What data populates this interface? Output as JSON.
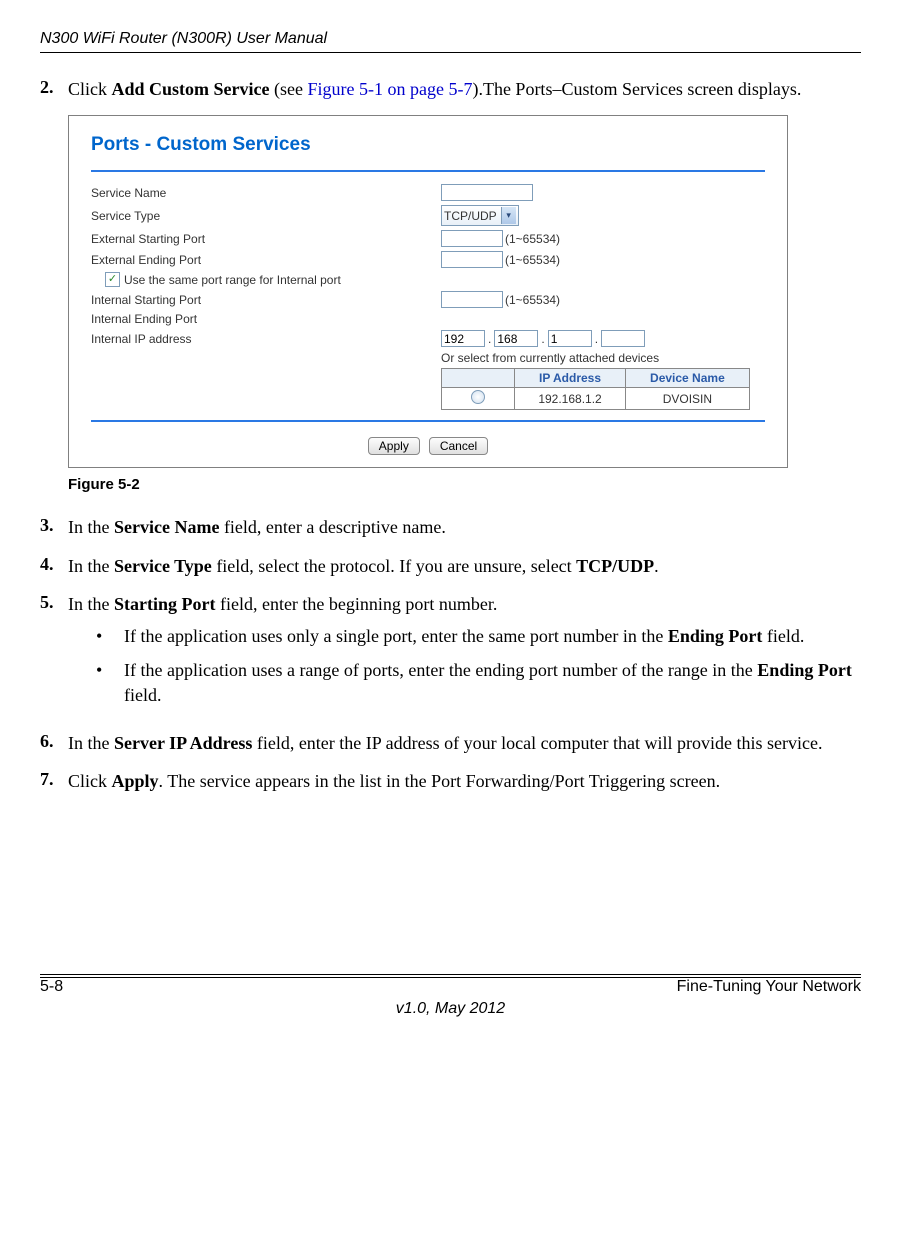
{
  "header_title": "N300 WiFi Router (N300R) User Manual",
  "steps": {
    "s2_num": "2.",
    "s2_a": "Click ",
    "s2_b": "Add Custom Service",
    "s2_c": " (see ",
    "s2_link": "Figure 5-1 on page 5-7",
    "s2_d": ").The Ports–Custom Services screen displays.",
    "s3_num": "3.",
    "s3_a": "In the ",
    "s3_b": "Service Name",
    "s3_c": " field, enter a descriptive name.",
    "s4_num": "4.",
    "s4_a": "In the ",
    "s4_b": "Service Type",
    "s4_c": " field, select the protocol. If you are unsure, select ",
    "s4_d": "TCP/UDP",
    "s4_e": ".",
    "s5_num": "5.",
    "s5_a": "In the ",
    "s5_b": "Starting Port",
    "s5_c": " field, enter the beginning port number.",
    "s5_bul1_a": "If the application uses only a single port, enter the same port number in the ",
    "s5_bul1_b": "Ending Port",
    "s5_bul1_c": " field.",
    "s5_bul2_a": "If the application uses a range of ports, enter the ending port number of the range in the ",
    "s5_bul2_b": "Ending Port",
    "s5_bul2_c": " field.",
    "s6_num": "6.",
    "s6_a": "In the ",
    "s6_b": "Server IP Address",
    "s6_c": " field, enter the IP address of your local computer that will provide this service.",
    "s7_num": "7.",
    "s7_a": "Click ",
    "s7_b": "Apply",
    "s7_c": ". The service appears in the list in the Port Forwarding/Port Triggering screen."
  },
  "figure": {
    "panel_title": "Ports - Custom Services",
    "labels": {
      "service_name": "Service Name",
      "service_type": "Service Type",
      "ext_start": "External Starting Port",
      "ext_end": "External Ending Port",
      "same_range": "Use the same port range for Internal port",
      "int_start": "Internal Starting Port",
      "int_end": "Internal Ending Port",
      "int_ip": "Internal IP address"
    },
    "service_type_value": "TCP/UDP",
    "port_hint": "(1~65534)",
    "ip": {
      "o1": "192",
      "o2": "168",
      "o3": "1",
      "o4": ""
    },
    "devices_note": "Or select from currently attached devices",
    "table": {
      "h_ip": "IP Address",
      "h_name": "Device Name",
      "row_ip": "192.168.1.2",
      "row_name": "DVOISIN"
    },
    "btn_apply": "Apply",
    "btn_cancel": "Cancel",
    "caption": "Figure 5-2"
  },
  "footer": {
    "page": "5-8",
    "section": "Fine-Tuning Your Network",
    "version": "v1.0, May 2012"
  },
  "glyphs": {
    "bullet": "•",
    "check": "✓",
    "down": "▾",
    "dot": "."
  }
}
